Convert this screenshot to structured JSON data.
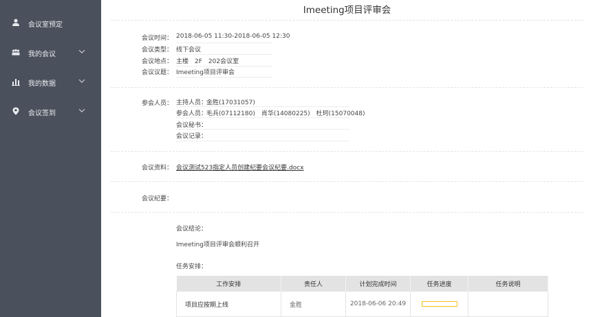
{
  "sidebar": {
    "items": [
      {
        "label": "会议室预定",
        "icon": "user-icon",
        "has_chevron": false
      },
      {
        "label": "我的会议",
        "icon": "group-icon",
        "has_chevron": true
      },
      {
        "label": "我的数据",
        "icon": "bar-chart-icon",
        "has_chevron": true
      },
      {
        "label": "会议签到",
        "icon": "location-pin-icon",
        "has_chevron": true
      }
    ],
    "bg_color": "#4a505c"
  },
  "meeting": {
    "title": "Imeeting项目评审会",
    "time_label": "会议时间：",
    "time_value": "2018-06-05 11:30-2018-06-05 12:30",
    "type_label": "会议类型：",
    "type_value": "线下会议",
    "location_label": "会议地点：",
    "location_value": "主楼　2F　202会议室",
    "topic_label": "会议议题：",
    "topic_value": "Imeeting项目评审会"
  },
  "participants": {
    "section_label": "参会人员：",
    "host_label": "主持人员：",
    "host_value": "金胜(17031057)",
    "attendees_label": "参会人员：",
    "attendees_value": "毛兵(07112180)　肖华(14080225)　杜珂(15070048)",
    "secretary_label": "会议秘书：",
    "secretary_value": "",
    "recorder_label": "会议记录：",
    "recorder_value": ""
  },
  "materials": {
    "label": "会议资料：",
    "file": "会议测试523指定人员创建纪要会议纪要.docx"
  },
  "minutes": {
    "label": "会议纪要：",
    "conclusion_label": "会议结论：",
    "conclusion_value": "Imeeting项目评审会顺利召开",
    "tasks_label": "任务安排："
  },
  "tasks_table": {
    "headers": [
      "工作安排",
      "责任人",
      "计划完成时间",
      "任务进度",
      "任务说明"
    ],
    "rows": [
      {
        "work": "项目应按期上线",
        "owner": "金胜",
        "due": "2018-06-06 20:49",
        "progress": 0,
        "note": ""
      }
    ],
    "progress_color": "#f0c419"
  }
}
